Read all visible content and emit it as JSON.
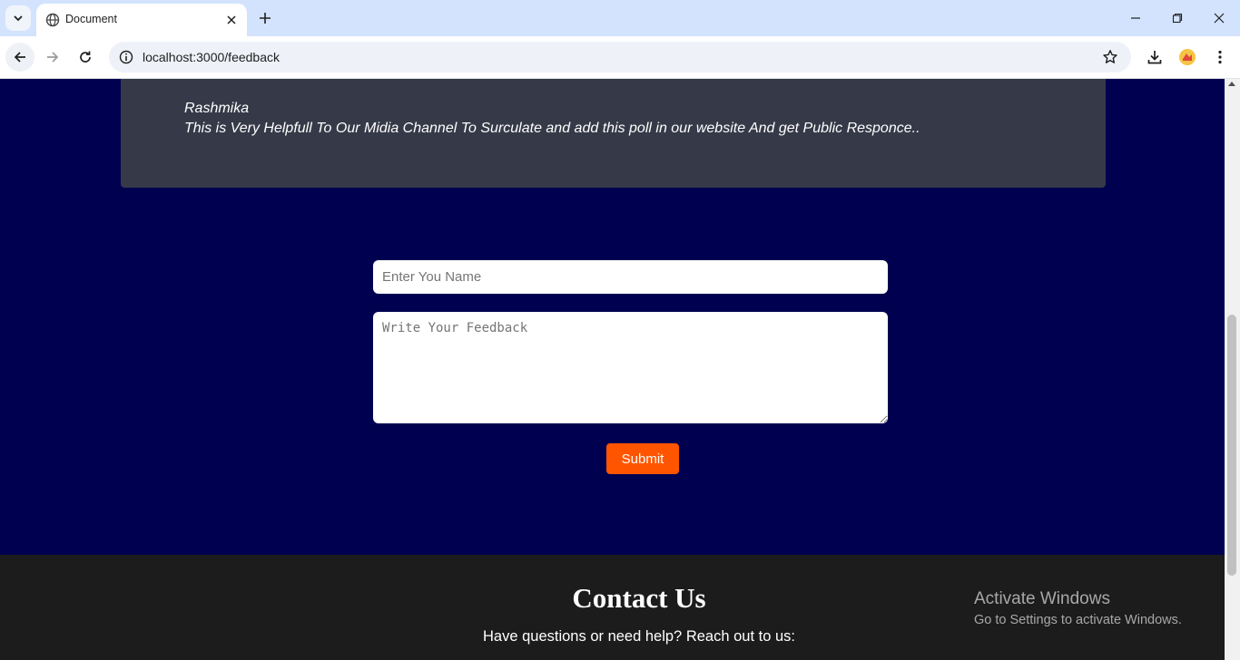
{
  "browser": {
    "tab_title": "Document",
    "url": "localhost:3000/feedback"
  },
  "feedback_card": {
    "name": "Rashmika",
    "text": "This is Very Helpfull To Our Midia Channel To Surculate and add this poll in our website And get Public Responce.."
  },
  "form": {
    "name_placeholder": "Enter You Name",
    "feedback_placeholder": "Write Your Feedback",
    "submit_label": "Submit"
  },
  "footer": {
    "title": "Contact Us",
    "subtitle": "Have questions or need help? Reach out to us:"
  },
  "watermark": {
    "title": "Activate Windows",
    "subtitle": "Go to Settings to activate Windows."
  },
  "colors": {
    "page_background": "#000050",
    "card_background": "#363a48",
    "submit_button": "#ff5500",
    "footer_background": "#1c1c1c"
  }
}
